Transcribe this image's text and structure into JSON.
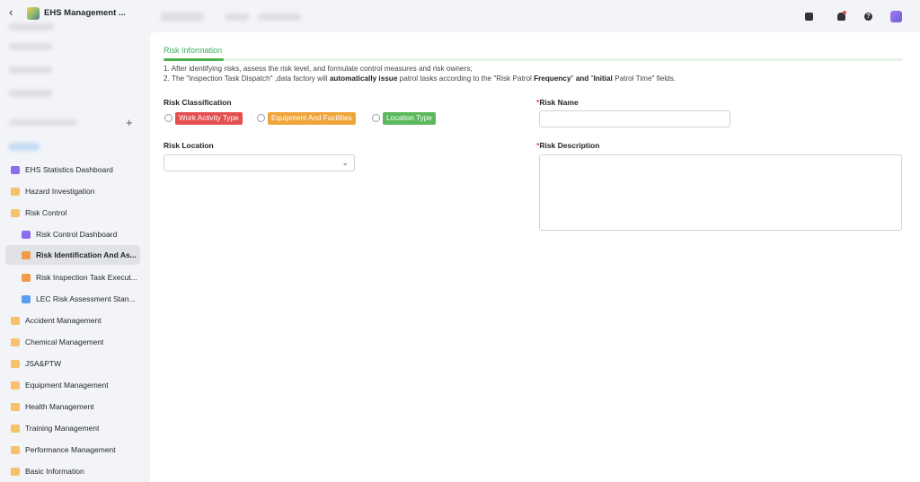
{
  "app": {
    "title": "EHS Management ...",
    "back_glyph": "‹",
    "add_glyph": "+"
  },
  "sidebar": {
    "items": [
      {
        "label": "EHS Statistics Dashboard",
        "icon": "dashboard-icon"
      },
      {
        "label": "Hazard Investigation",
        "icon": "folder-icon"
      },
      {
        "label": "Risk Control",
        "icon": "folder-icon"
      },
      {
        "label": "Risk Control Dashboard",
        "icon": "dashboard-icon"
      },
      {
        "label": "Risk Identification And As...",
        "icon": "document-icon"
      },
      {
        "label": "Risk Inspection Task Execut...",
        "icon": "document-icon"
      },
      {
        "label": "LEC Risk Assessment Stan...",
        "icon": "document-icon"
      },
      {
        "label": "Accident Management",
        "icon": "folder-icon"
      },
      {
        "label": "Chemical Management",
        "icon": "folder-icon"
      },
      {
        "label": "JSA&PTW",
        "icon": "folder-icon"
      },
      {
        "label": "Equipment Management",
        "icon": "folder-icon"
      },
      {
        "label": "Health Management",
        "icon": "folder-icon"
      },
      {
        "label": "Training Management",
        "icon": "folder-icon"
      },
      {
        "label": "Performance Management",
        "icon": "folder-icon"
      },
      {
        "label": "Basic Information",
        "icon": "folder-icon"
      }
    ]
  },
  "topbar": {
    "help_glyph": "?"
  },
  "tab": {
    "label": "Risk Information"
  },
  "notes": {
    "line1": "1. After identifying risks, assess the risk level, and formulate control measures and risk owners;",
    "line2_a": "2. The \"Inspection Task Dispatch\" ,data factory will ",
    "line2_b": "automatically issue",
    "line2_c": " patrol tasks according to the \"Risk Patrol ",
    "line2_d": "Frequency",
    "line2_e": "\" ",
    "line2_f": "and",
    "line2_g": " \"",
    "line2_h": "Initial",
    "line2_i": " Patrol Time\" fields."
  },
  "form": {
    "risk_classification_label": "Risk Classification",
    "risk_classification_options": [
      "Work Activity Type",
      "Equipment And Facilities",
      "Location Type"
    ],
    "risk_location_label": "Risk Location",
    "risk_location_value": "",
    "risk_name_label": "Risk Name",
    "risk_name_value": "",
    "risk_description_label": "Risk Description",
    "risk_description_value": "",
    "required_mark": "*",
    "chevron_glyph": "⌄"
  },
  "colors": {
    "accent": "#4caf50",
    "tag_red": "#e45050",
    "tag_orange": "#f0a53a",
    "tag_green": "#5cb85c"
  }
}
